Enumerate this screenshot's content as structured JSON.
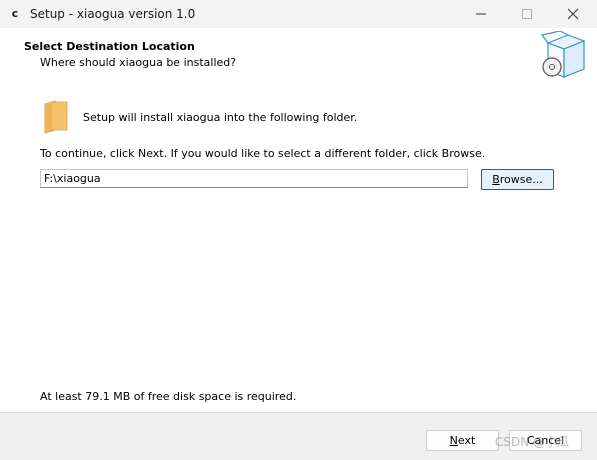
{
  "window": {
    "app_icon_letter": "c",
    "title": "Setup - xiaogua version 1.0"
  },
  "header": {
    "title": "Select Destination Location",
    "subtitle": "Where should xiaogua be installed?"
  },
  "body": {
    "install_text": "Setup will install xiaogua into the following folder.",
    "continue_text": "To continue, click Next. If you would like to select a different folder, click Browse.",
    "path_value": "F:\\xiaogua",
    "browse_mnemonic": "B",
    "browse_rest": "rowse...",
    "disk_space_text": "At least 79.1 MB of free disk space is required."
  },
  "footer": {
    "next_mnemonic": "N",
    "next_rest": "ext",
    "cancel_label": "Cancel"
  },
  "watermark": "CSDN @小瓜",
  "colors": {
    "titlebar_bg": "#f3f3f3",
    "footer_bg": "#f0f0f0",
    "focus_border": "#0067c0",
    "folder": "#f5c26b"
  }
}
